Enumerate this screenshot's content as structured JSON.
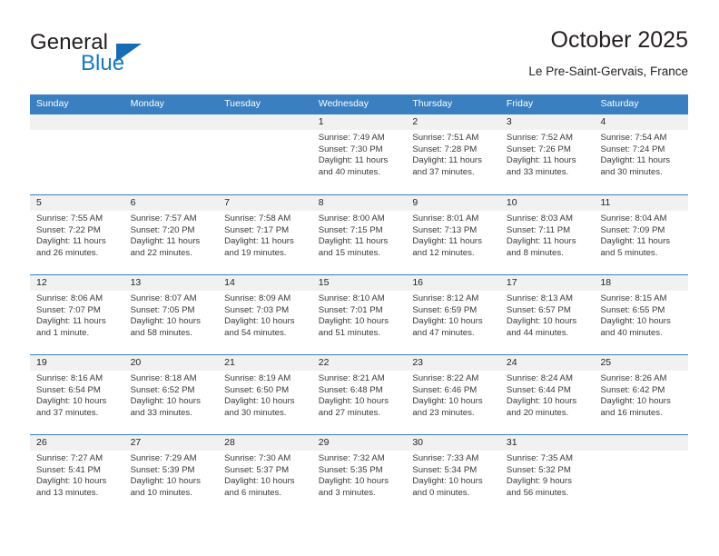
{
  "brand": {
    "name_part1": "General",
    "name_part2": "Blue",
    "accent_color": "#176cb4",
    "triangle_icon": "triangle-icon"
  },
  "header": {
    "title": "October 2025",
    "subtitle": "Le Pre-Saint-Gervais, France"
  },
  "calendar": {
    "header_bg": "#3a7fc0",
    "daynum_bg": "#f1f1f1",
    "weekdays": [
      "Sunday",
      "Monday",
      "Tuesday",
      "Wednesday",
      "Thursday",
      "Friday",
      "Saturday"
    ],
    "weeks": [
      [
        {
          "day": "",
          "empty": true
        },
        {
          "day": "",
          "empty": true
        },
        {
          "day": "",
          "empty": true
        },
        {
          "day": "1",
          "sunrise": "Sunrise: 7:49 AM",
          "sunset": "Sunset: 7:30 PM",
          "daylight_line1": "Daylight: 11 hours",
          "daylight_line2": "and 40 minutes."
        },
        {
          "day": "2",
          "sunrise": "Sunrise: 7:51 AM",
          "sunset": "Sunset: 7:28 PM",
          "daylight_line1": "Daylight: 11 hours",
          "daylight_line2": "and 37 minutes."
        },
        {
          "day": "3",
          "sunrise": "Sunrise: 7:52 AM",
          "sunset": "Sunset: 7:26 PM",
          "daylight_line1": "Daylight: 11 hours",
          "daylight_line2": "and 33 minutes."
        },
        {
          "day": "4",
          "sunrise": "Sunrise: 7:54 AM",
          "sunset": "Sunset: 7:24 PM",
          "daylight_line1": "Daylight: 11 hours",
          "daylight_line2": "and 30 minutes."
        }
      ],
      [
        {
          "day": "5",
          "sunrise": "Sunrise: 7:55 AM",
          "sunset": "Sunset: 7:22 PM",
          "daylight_line1": "Daylight: 11 hours",
          "daylight_line2": "and 26 minutes."
        },
        {
          "day": "6",
          "sunrise": "Sunrise: 7:57 AM",
          "sunset": "Sunset: 7:20 PM",
          "daylight_line1": "Daylight: 11 hours",
          "daylight_line2": "and 22 minutes."
        },
        {
          "day": "7",
          "sunrise": "Sunrise: 7:58 AM",
          "sunset": "Sunset: 7:17 PM",
          "daylight_line1": "Daylight: 11 hours",
          "daylight_line2": "and 19 minutes."
        },
        {
          "day": "8",
          "sunrise": "Sunrise: 8:00 AM",
          "sunset": "Sunset: 7:15 PM",
          "daylight_line1": "Daylight: 11 hours",
          "daylight_line2": "and 15 minutes."
        },
        {
          "day": "9",
          "sunrise": "Sunrise: 8:01 AM",
          "sunset": "Sunset: 7:13 PM",
          "daylight_line1": "Daylight: 11 hours",
          "daylight_line2": "and 12 minutes."
        },
        {
          "day": "10",
          "sunrise": "Sunrise: 8:03 AM",
          "sunset": "Sunset: 7:11 PM",
          "daylight_line1": "Daylight: 11 hours",
          "daylight_line2": "and 8 minutes."
        },
        {
          "day": "11",
          "sunrise": "Sunrise: 8:04 AM",
          "sunset": "Sunset: 7:09 PM",
          "daylight_line1": "Daylight: 11 hours",
          "daylight_line2": "and 5 minutes."
        }
      ],
      [
        {
          "day": "12",
          "sunrise": "Sunrise: 8:06 AM",
          "sunset": "Sunset: 7:07 PM",
          "daylight_line1": "Daylight: 11 hours",
          "daylight_line2": "and 1 minute."
        },
        {
          "day": "13",
          "sunrise": "Sunrise: 8:07 AM",
          "sunset": "Sunset: 7:05 PM",
          "daylight_line1": "Daylight: 10 hours",
          "daylight_line2": "and 58 minutes."
        },
        {
          "day": "14",
          "sunrise": "Sunrise: 8:09 AM",
          "sunset": "Sunset: 7:03 PM",
          "daylight_line1": "Daylight: 10 hours",
          "daylight_line2": "and 54 minutes."
        },
        {
          "day": "15",
          "sunrise": "Sunrise: 8:10 AM",
          "sunset": "Sunset: 7:01 PM",
          "daylight_line1": "Daylight: 10 hours",
          "daylight_line2": "and 51 minutes."
        },
        {
          "day": "16",
          "sunrise": "Sunrise: 8:12 AM",
          "sunset": "Sunset: 6:59 PM",
          "daylight_line1": "Daylight: 10 hours",
          "daylight_line2": "and 47 minutes."
        },
        {
          "day": "17",
          "sunrise": "Sunrise: 8:13 AM",
          "sunset": "Sunset: 6:57 PM",
          "daylight_line1": "Daylight: 10 hours",
          "daylight_line2": "and 44 minutes."
        },
        {
          "day": "18",
          "sunrise": "Sunrise: 8:15 AM",
          "sunset": "Sunset: 6:55 PM",
          "daylight_line1": "Daylight: 10 hours",
          "daylight_line2": "and 40 minutes."
        }
      ],
      [
        {
          "day": "19",
          "sunrise": "Sunrise: 8:16 AM",
          "sunset": "Sunset: 6:54 PM",
          "daylight_line1": "Daylight: 10 hours",
          "daylight_line2": "and 37 minutes."
        },
        {
          "day": "20",
          "sunrise": "Sunrise: 8:18 AM",
          "sunset": "Sunset: 6:52 PM",
          "daylight_line1": "Daylight: 10 hours",
          "daylight_line2": "and 33 minutes."
        },
        {
          "day": "21",
          "sunrise": "Sunrise: 8:19 AM",
          "sunset": "Sunset: 6:50 PM",
          "daylight_line1": "Daylight: 10 hours",
          "daylight_line2": "and 30 minutes."
        },
        {
          "day": "22",
          "sunrise": "Sunrise: 8:21 AM",
          "sunset": "Sunset: 6:48 PM",
          "daylight_line1": "Daylight: 10 hours",
          "daylight_line2": "and 27 minutes."
        },
        {
          "day": "23",
          "sunrise": "Sunrise: 8:22 AM",
          "sunset": "Sunset: 6:46 PM",
          "daylight_line1": "Daylight: 10 hours",
          "daylight_line2": "and 23 minutes."
        },
        {
          "day": "24",
          "sunrise": "Sunrise: 8:24 AM",
          "sunset": "Sunset: 6:44 PM",
          "daylight_line1": "Daylight: 10 hours",
          "daylight_line2": "and 20 minutes."
        },
        {
          "day": "25",
          "sunrise": "Sunrise: 8:26 AM",
          "sunset": "Sunset: 6:42 PM",
          "daylight_line1": "Daylight: 10 hours",
          "daylight_line2": "and 16 minutes."
        }
      ],
      [
        {
          "day": "26",
          "sunrise": "Sunrise: 7:27 AM",
          "sunset": "Sunset: 5:41 PM",
          "daylight_line1": "Daylight: 10 hours",
          "daylight_line2": "and 13 minutes."
        },
        {
          "day": "27",
          "sunrise": "Sunrise: 7:29 AM",
          "sunset": "Sunset: 5:39 PM",
          "daylight_line1": "Daylight: 10 hours",
          "daylight_line2": "and 10 minutes."
        },
        {
          "day": "28",
          "sunrise": "Sunrise: 7:30 AM",
          "sunset": "Sunset: 5:37 PM",
          "daylight_line1": "Daylight: 10 hours",
          "daylight_line2": "and 6 minutes."
        },
        {
          "day": "29",
          "sunrise": "Sunrise: 7:32 AM",
          "sunset": "Sunset: 5:35 PM",
          "daylight_line1": "Daylight: 10 hours",
          "daylight_line2": "and 3 minutes."
        },
        {
          "day": "30",
          "sunrise": "Sunrise: 7:33 AM",
          "sunset": "Sunset: 5:34 PM",
          "daylight_line1": "Daylight: 10 hours",
          "daylight_line2": "and 0 minutes."
        },
        {
          "day": "31",
          "sunrise": "Sunrise: 7:35 AM",
          "sunset": "Sunset: 5:32 PM",
          "daylight_line1": "Daylight: 9 hours",
          "daylight_line2": "and 56 minutes."
        },
        {
          "day": "",
          "empty": true
        }
      ]
    ]
  }
}
